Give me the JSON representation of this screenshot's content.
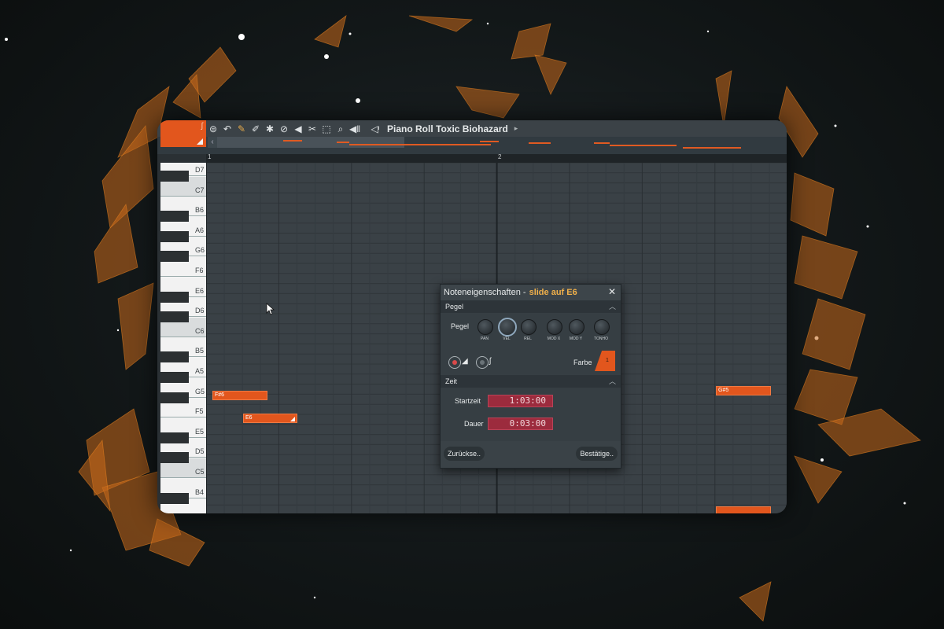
{
  "toolbar": {
    "title": "Piano Roll Toxic Biohazard",
    "icons": [
      "play-arrow-icon",
      "wrench-icon",
      "magnet-icon",
      "menu-icon",
      "undo-icon",
      "pencil-icon",
      "paint-icon",
      "stamp-icon",
      "erase-icon",
      "mute-icon",
      "slice-icon",
      "select-icon",
      "zoom-icon",
      "playback-icon",
      "speaker-icon"
    ]
  },
  "ruler": {
    "bar_1": "1",
    "bar_2": "2"
  },
  "keyboard": {
    "labels": [
      "D7",
      "C7",
      "B6",
      "A6",
      "G6",
      "F6",
      "E6",
      "D6",
      "C6",
      "B5",
      "A5",
      "G5",
      "F5",
      "E5",
      "D5",
      "C5",
      "B4"
    ]
  },
  "notes": [
    {
      "label": "F#6"
    },
    {
      "label": "E6"
    },
    {
      "label": "G#5"
    }
  ],
  "dialog": {
    "title": "Noteneigenschaften -",
    "subtitle": "slide auf E6",
    "close": "✕",
    "pegel_header": "Pegel",
    "pegel_label": "Pegel",
    "knobs": [
      "PAN",
      "VEL",
      "REL",
      "MOD X",
      "MOD Y",
      "TONHO"
    ],
    "farbe_label": "Farbe",
    "farbe_value": "1",
    "zeit_header": "Zeit",
    "startzeit_label": "Startzeit",
    "startzeit_value": "1:03:00",
    "dauer_label": "Dauer",
    "dauer_value": "0:03:00",
    "reset_button": "Zurückse..",
    "confirm_button": "Bestätige.."
  },
  "colors": {
    "accent": "#e2561d",
    "field": "#9c2b3d",
    "subtitle": "#f0b04a"
  }
}
